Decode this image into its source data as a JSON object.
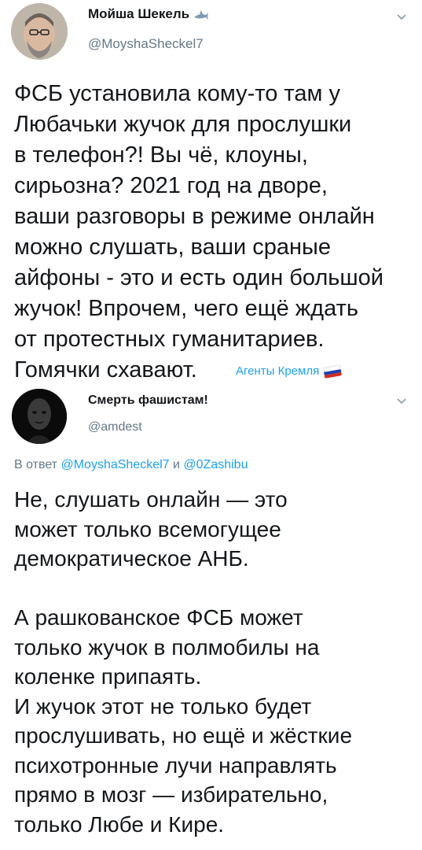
{
  "tweets": [
    {
      "author": {
        "name": "Мойша Шекель",
        "handle": "@MoyshaSheckel7",
        "badge": "shark-emoji"
      },
      "text": "ФСБ установила кому-то там у\nЛюбачьки жучок для прослушки\nв телефон?! Вы чё, клоуны,\nсирьозна? 2021 год на дворе,\nваши разговоры в режиме онлайн\nможно слушать, ваши сраные\nайфоны - это и есть один большой\nжучок! Впрочем, чего ещё ждать\nот протестных гуманитариев.\nГомячки схавают.",
      "source_label": "Агенты Кремля",
      "source_flag": [
        "#ffffff",
        "#1c3fb0",
        "#d52b1e"
      ]
    },
    {
      "author": {
        "name": "Смерть фашистам!",
        "handle": "@amdest"
      },
      "reply_prefix": "В ответ",
      "reply_user1": "@MoyshaSheckel7",
      "reply_and": "и",
      "reply_user2": "@0Zashibu",
      "text": "Не, слушать онлайн — это\nможет только всемогущее\nдемократическое АНБ.\n\nА рашкованское ФСБ может\nтолько жучок в полмобилы на\nколенке припаять.\nИ жучок этот не только будет\nпрослушивать, но ещё и жёсткие\nпсихотронные лучи направлять\nпрямо в мозг — избирательно,\nтолько Любе и Кире."
    }
  ],
  "colors": {
    "text": "#14171a",
    "secondary": "#657786",
    "link": "#1da1f2"
  }
}
